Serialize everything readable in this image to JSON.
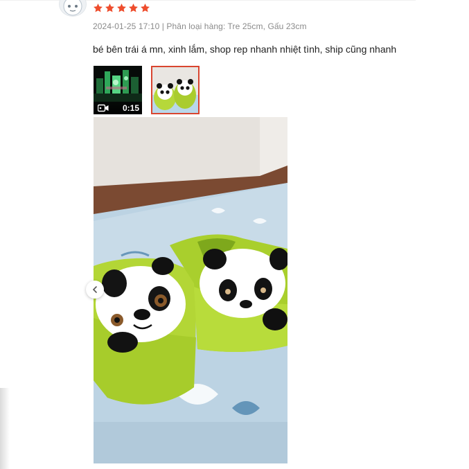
{
  "review": {
    "rating": 5,
    "meta": "2024-01-25 17:10 | Phân loại hàng: Tre 25cm, Gấu 23cm",
    "comment": "bé bên trái á mn, xinh lắm, shop rep nhanh nhiệt tình, ship cũng nhanh",
    "star_color": "#ee4d2d"
  },
  "media": {
    "video_thumb": {
      "duration": "0:15",
      "icon": "video-camera-icon"
    },
    "photo_thumb": {
      "selected": true,
      "border_color": "#d9452f"
    },
    "viewer": {
      "prev_icon": "chevron-left-icon"
    }
  }
}
